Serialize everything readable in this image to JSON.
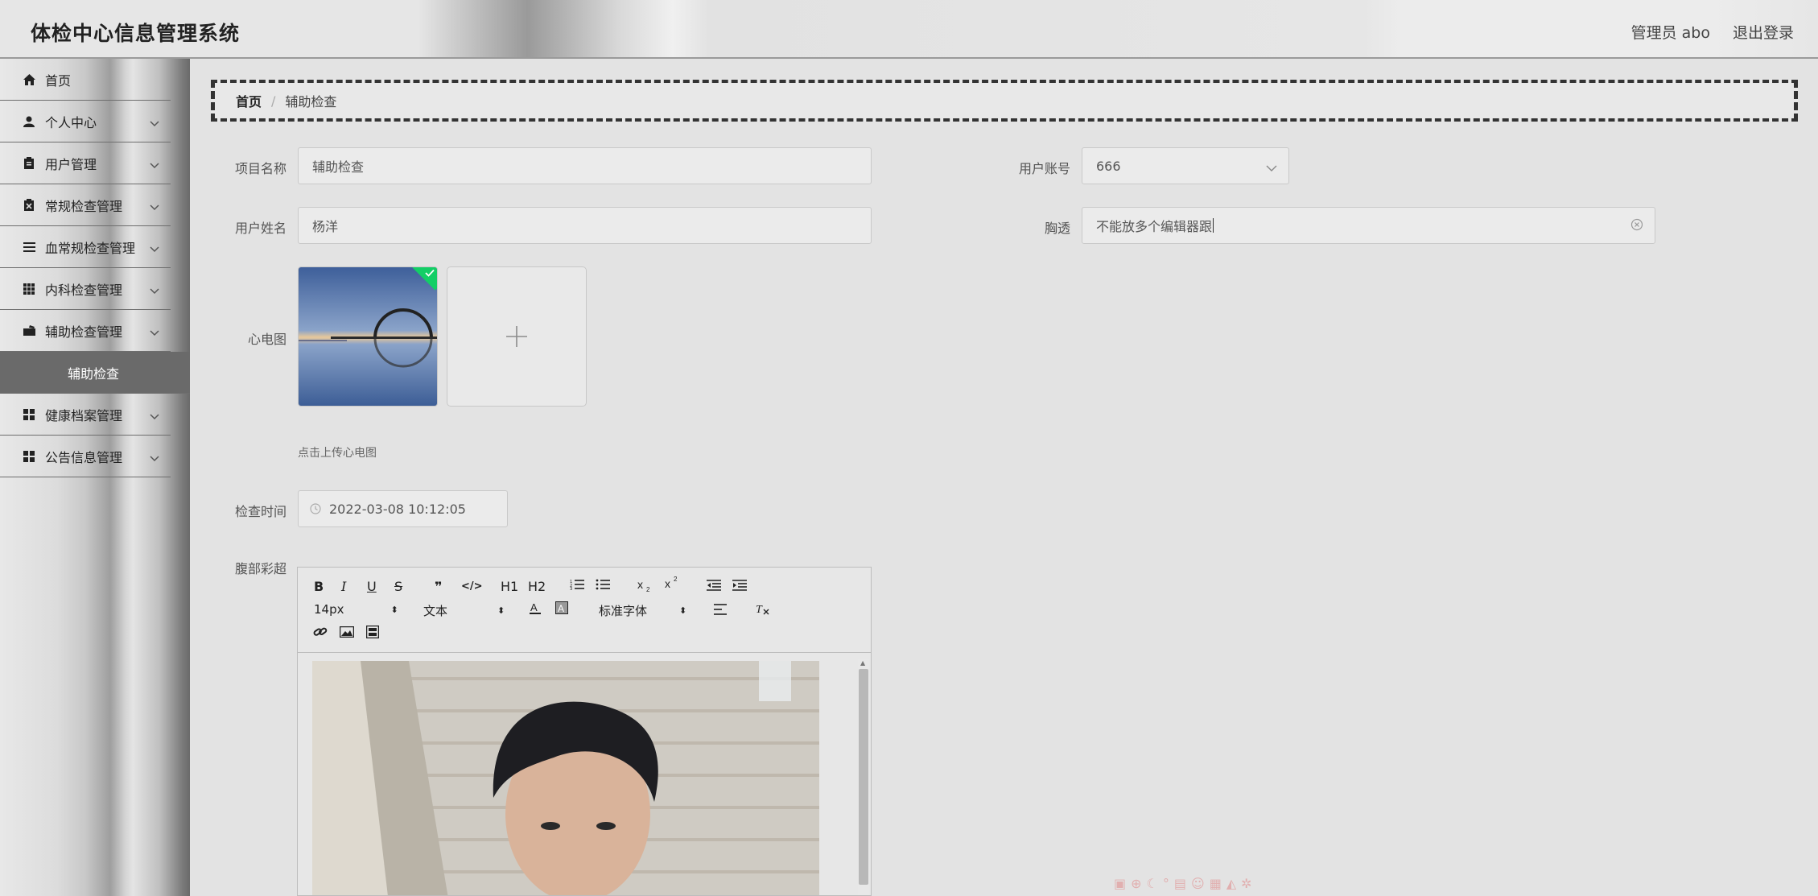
{
  "app": {
    "title": "体检中心信息管理系统"
  },
  "header": {
    "user": "管理员 abo",
    "logout": "退出登录"
  },
  "sidebar": {
    "items": [
      {
        "label": "首页",
        "icon": "home-icon",
        "chevron": false
      },
      {
        "label": "个人中心",
        "icon": "user-icon",
        "chevron": true
      },
      {
        "label": "用户管理",
        "icon": "clipboard-icon",
        "chevron": true
      },
      {
        "label": "常规检查管理",
        "icon": "clipboard-x-icon",
        "chevron": true
      },
      {
        "label": "血常规检查管理",
        "icon": "list-icon",
        "chevron": true
      },
      {
        "label": "内科检查管理",
        "icon": "grid-icon",
        "chevron": true
      },
      {
        "label": "辅助检查管理",
        "icon": "folder-icon",
        "chevron": true
      }
    ],
    "active_sub": "辅助检查",
    "items_after": [
      {
        "label": "健康档案管理",
        "icon": "apps-icon",
        "chevron": true
      },
      {
        "label": "公告信息管理",
        "icon": "apps-icon",
        "chevron": true
      }
    ]
  },
  "breadcrumb": {
    "home": "首页",
    "separator": "/",
    "current": "辅助检查"
  },
  "form": {
    "project_name": {
      "label": "项目名称",
      "value": "辅助检查"
    },
    "user_account": {
      "label": "用户账号",
      "value": "666"
    },
    "user_name": {
      "label": "用户姓名",
      "value": "杨洋"
    },
    "chest": {
      "label": "胸透",
      "value": "不能放多个编辑器跟"
    },
    "ecg": {
      "label": "心电图",
      "tip": "点击上传心电图"
    },
    "check_time": {
      "label": "检查时间",
      "value": "2022-03-08 10:12:05"
    },
    "abdomen": {
      "label": "腹部彩超"
    }
  },
  "editor_toolbar": {
    "bold": "B",
    "italic": "I",
    "underline": "U",
    "strike": "S",
    "quote": "❞",
    "code": "</>",
    "h1": "H1",
    "h2": "H2",
    "font_size": "14px",
    "text": "文本",
    "font_family": "标准字体"
  },
  "colors": {
    "accent": "#13ce66",
    "sidebar_active": "#6a6a6a"
  }
}
